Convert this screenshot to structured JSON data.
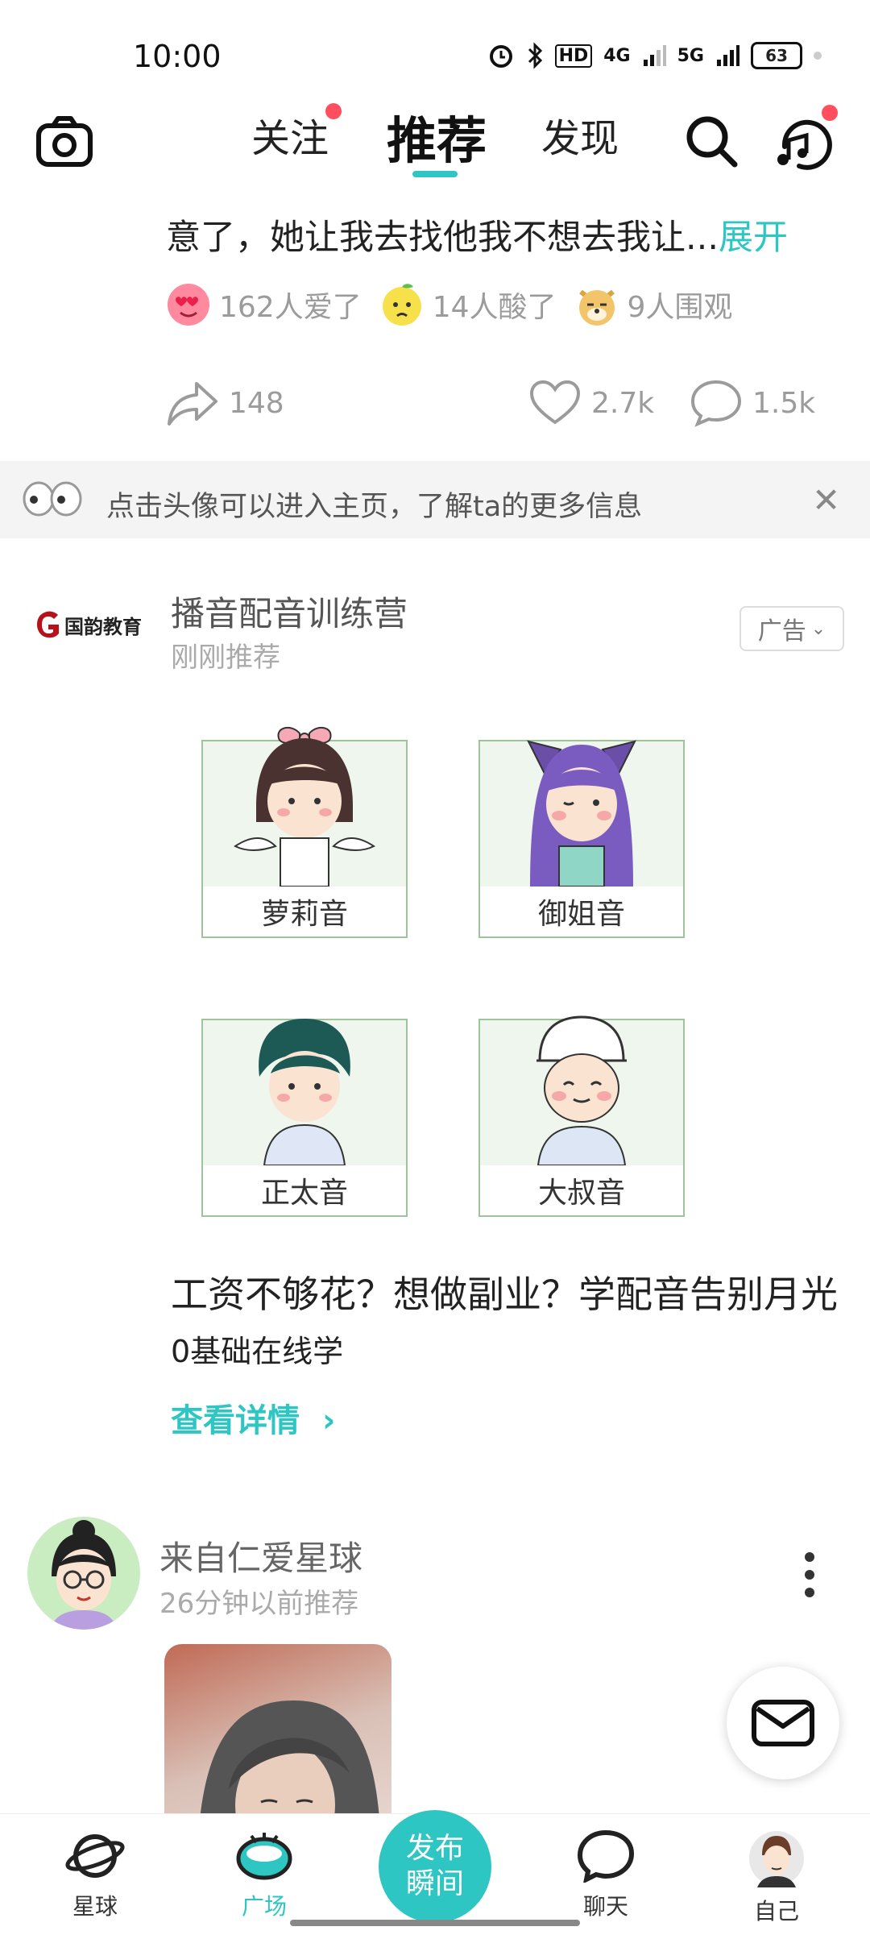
{
  "status_bar": {
    "time": "10:00",
    "hd_label": "HD",
    "net_4g": "4G",
    "net_5g": "5G",
    "battery": "63"
  },
  "top_nav": {
    "tabs": [
      {
        "label": "关注",
        "has_dot": true
      },
      {
        "label": "推荐",
        "active": true
      },
      {
        "label": "发现"
      }
    ],
    "accent_color": "#2ec6c2",
    "notify_color": "#ff4f5e"
  },
  "post": {
    "text": "意了，她让我去找他我不想去我让...",
    "expand_label": "展开",
    "reactions": [
      {
        "icon": "heart-eyes-emoji-icon",
        "text": "162人爱了"
      },
      {
        "icon": "sour-lemon-emoji-icon",
        "text": "14人酸了"
      },
      {
        "icon": "doge-emoji-icon",
        "text": "9人围观"
      }
    ],
    "share_count": "148",
    "like_count": "2.7k",
    "comment_count": "1.5k"
  },
  "tip": {
    "text": "点击头像可以进入主页，了解ta的更多信息"
  },
  "ad": {
    "logo_text": "国韵教育",
    "title": "播音配音训练营",
    "subtitle": "刚刚推荐",
    "badge": "广告",
    "voices": [
      "萝莉音",
      "御姐音",
      "正太音",
      "大叔音"
    ],
    "headline": "工资不够花？想做副业？学配音告别月光",
    "line2": "0基础在线学",
    "link": "查看详情"
  },
  "next_post": {
    "from": "来自仁爱星球",
    "time": "26分钟以前推荐"
  },
  "bottom_nav": {
    "items": [
      {
        "label": "星球"
      },
      {
        "label": "广场",
        "active": true
      },
      {
        "label": "聊天"
      },
      {
        "label": "自己"
      }
    ],
    "publish_line1": "发布",
    "publish_line2": "瞬间"
  }
}
